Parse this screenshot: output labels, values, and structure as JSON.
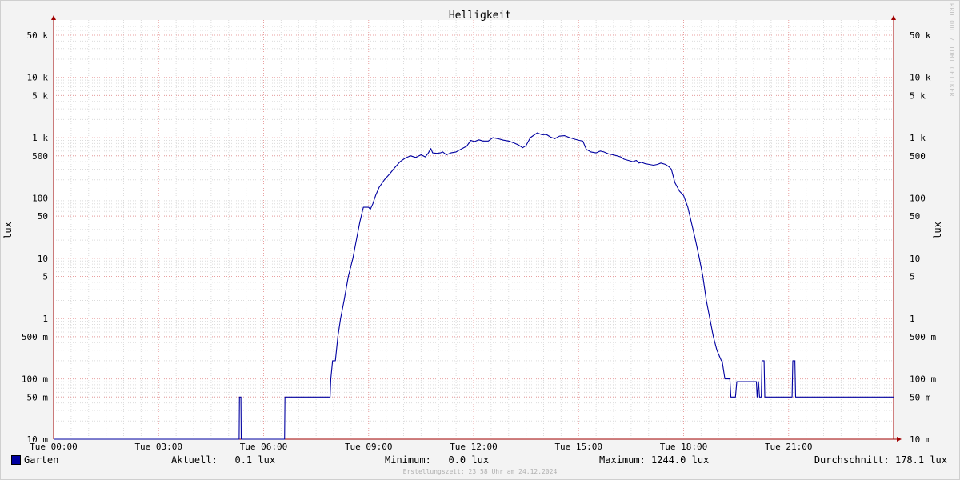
{
  "chart_data": {
    "type": "line",
    "title": "Helligkeit",
    "ylabel": "lux",
    "ylabel_right": "lux",
    "yscale": "log",
    "ylim": [
      0.01,
      70000
    ],
    "xlim_hours": [
      0,
      24
    ],
    "grid": true,
    "x_ticks": [
      {
        "hour": 0,
        "label": "Tue 00:00"
      },
      {
        "hour": 3,
        "label": "Tue 03:00"
      },
      {
        "hour": 6,
        "label": "Tue 06:00"
      },
      {
        "hour": 9,
        "label": "Tue 09:00"
      },
      {
        "hour": 12,
        "label": "Tue 12:00"
      },
      {
        "hour": 15,
        "label": "Tue 15:00"
      },
      {
        "hour": 18,
        "label": "Tue 18:00"
      },
      {
        "hour": 21,
        "label": "Tue 21:00"
      }
    ],
    "y_ticks": [
      {
        "value": 0.01,
        "label": "10 m"
      },
      {
        "value": 0.05,
        "label": "50 m"
      },
      {
        "value": 0.1,
        "label": "100 m"
      },
      {
        "value": 0.5,
        "label": "500 m"
      },
      {
        "value": 1,
        "label": "1"
      },
      {
        "value": 5,
        "label": "5"
      },
      {
        "value": 10,
        "label": "10"
      },
      {
        "value": 50,
        "label": "50"
      },
      {
        "value": 100,
        "label": "100"
      },
      {
        "value": 500,
        "label": "500"
      },
      {
        "value": 1000,
        "label": "1 k"
      },
      {
        "value": 5000,
        "label": "5 k"
      },
      {
        "value": 10000,
        "label": "10 k"
      },
      {
        "value": 50000,
        "label": "50 k"
      }
    ],
    "series": [
      {
        "name": "Garten",
        "color": "#0000a0",
        "points": [
          [
            0.0,
            0.01
          ],
          [
            5.3,
            0.01
          ],
          [
            5.31,
            0.05
          ],
          [
            5.35,
            0.05
          ],
          [
            5.36,
            0.01
          ],
          [
            6.6,
            0.01
          ],
          [
            6.61,
            0.05
          ],
          [
            7.9,
            0.05
          ],
          [
            7.92,
            0.1
          ],
          [
            7.97,
            0.2
          ],
          [
            8.05,
            0.2
          ],
          [
            8.12,
            0.5
          ],
          [
            8.2,
            1
          ],
          [
            8.3,
            2
          ],
          [
            8.42,
            5
          ],
          [
            8.55,
            10
          ],
          [
            8.65,
            20
          ],
          [
            8.75,
            40
          ],
          [
            8.85,
            70
          ],
          [
            9.0,
            70
          ],
          [
            9.05,
            65
          ],
          [
            9.12,
            80
          ],
          [
            9.2,
            110
          ],
          [
            9.3,
            150
          ],
          [
            9.45,
            200
          ],
          [
            9.6,
            250
          ],
          [
            9.75,
            320
          ],
          [
            9.9,
            400
          ],
          [
            10.05,
            460
          ],
          [
            10.2,
            500
          ],
          [
            10.35,
            470
          ],
          [
            10.5,
            520
          ],
          [
            10.62,
            480
          ],
          [
            10.7,
            550
          ],
          [
            10.78,
            660
          ],
          [
            10.83,
            560
          ],
          [
            10.95,
            550
          ],
          [
            11.05,
            560
          ],
          [
            11.12,
            580
          ],
          [
            11.22,
            520
          ],
          [
            11.35,
            560
          ],
          [
            11.5,
            580
          ],
          [
            11.65,
            650
          ],
          [
            11.8,
            720
          ],
          [
            11.92,
            900
          ],
          [
            12.02,
            860
          ],
          [
            12.15,
            920
          ],
          [
            12.27,
            880
          ],
          [
            12.42,
            880
          ],
          [
            12.55,
            1000
          ],
          [
            12.7,
            960
          ],
          [
            12.85,
            910
          ],
          [
            13.0,
            880
          ],
          [
            13.15,
            820
          ],
          [
            13.28,
            760
          ],
          [
            13.4,
            680
          ],
          [
            13.5,
            740
          ],
          [
            13.62,
            1000
          ],
          [
            13.72,
            1100
          ],
          [
            13.82,
            1200
          ],
          [
            13.95,
            1120
          ],
          [
            14.08,
            1130
          ],
          [
            14.2,
            1020
          ],
          [
            14.32,
            960
          ],
          [
            14.45,
            1060
          ],
          [
            14.6,
            1080
          ],
          [
            14.75,
            1000
          ],
          [
            14.9,
            940
          ],
          [
            15.02,
            900
          ],
          [
            15.12,
            880
          ],
          [
            15.22,
            640
          ],
          [
            15.35,
            580
          ],
          [
            15.5,
            560
          ],
          [
            15.62,
            600
          ],
          [
            15.72,
            580
          ],
          [
            15.85,
            540
          ],
          [
            15.98,
            520
          ],
          [
            16.1,
            500
          ],
          [
            16.2,
            480
          ],
          [
            16.3,
            440
          ],
          [
            16.42,
            420
          ],
          [
            16.55,
            400
          ],
          [
            16.65,
            420
          ],
          [
            16.72,
            380
          ],
          [
            16.8,
            390
          ],
          [
            16.9,
            370
          ],
          [
            17.02,
            360
          ],
          [
            17.14,
            350
          ],
          [
            17.25,
            360
          ],
          [
            17.35,
            380
          ],
          [
            17.48,
            360
          ],
          [
            17.58,
            330
          ],
          [
            17.65,
            300
          ],
          [
            17.75,
            180
          ],
          [
            17.88,
            130
          ],
          [
            18.0,
            110
          ],
          [
            18.12,
            70
          ],
          [
            18.22,
            40
          ],
          [
            18.34,
            20
          ],
          [
            18.45,
            10
          ],
          [
            18.55,
            5
          ],
          [
            18.65,
            2
          ],
          [
            18.75,
            1
          ],
          [
            18.85,
            0.5
          ],
          [
            18.95,
            0.3
          ],
          [
            19.08,
            0.2
          ],
          [
            19.1,
            0.2
          ],
          [
            19.18,
            0.1
          ],
          [
            19.32,
            0.1
          ],
          [
            19.35,
            0.05
          ],
          [
            19.48,
            0.05
          ],
          [
            19.52,
            0.09
          ],
          [
            19.8,
            0.09
          ],
          [
            20.08,
            0.09
          ],
          [
            20.1,
            0.05
          ],
          [
            20.14,
            0.09
          ],
          [
            20.17,
            0.05
          ],
          [
            20.22,
            0.05
          ],
          [
            20.24,
            0.2
          ],
          [
            20.3,
            0.2
          ],
          [
            20.32,
            0.05
          ],
          [
            21.1,
            0.05
          ],
          [
            21.12,
            0.2
          ],
          [
            21.18,
            0.2
          ],
          [
            21.2,
            0.05
          ],
          [
            24.0,
            0.05
          ]
        ]
      }
    ]
  },
  "legend": {
    "series_name": "Garten",
    "current": "Aktuell:   0.1 lux",
    "minimum": "Minimum:   0.0 lux",
    "maximum": "Maximum: 1244.0 lux",
    "average": "Durchschnitt: 178.1 lux"
  },
  "footer": {
    "created": "Erstellungszeit: 23:58 Uhr am 24.12.2024"
  },
  "watermark": "RRDTOOL / TOBI OETIKER"
}
